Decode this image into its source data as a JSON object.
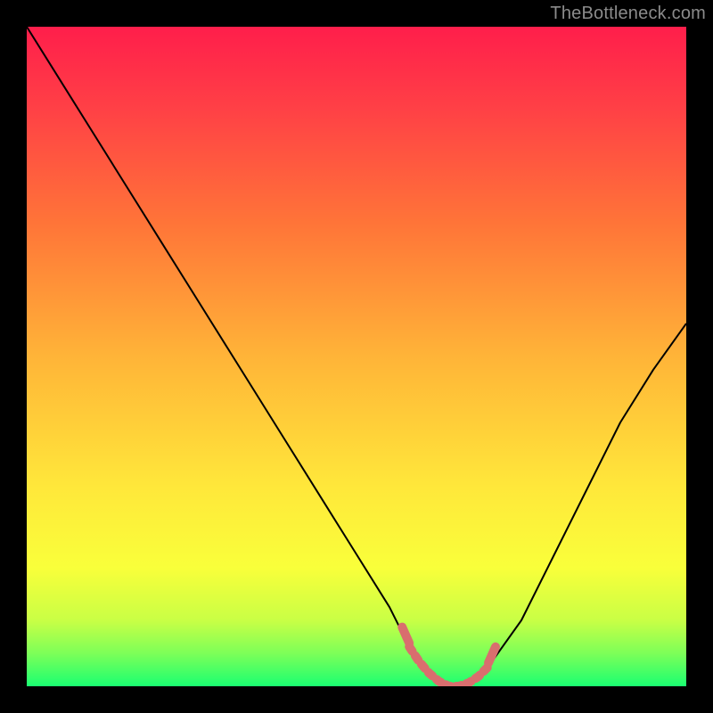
{
  "watermark": "TheBottleneck.com",
  "chart_data": {
    "type": "line",
    "title": "",
    "xlabel": "",
    "ylabel": "",
    "xlim": [
      0,
      100
    ],
    "ylim": [
      0,
      100
    ],
    "x": [
      0,
      5,
      10,
      15,
      20,
      25,
      30,
      35,
      40,
      45,
      50,
      55,
      58,
      60,
      62,
      64,
      66,
      68,
      70,
      75,
      80,
      85,
      90,
      95,
      100
    ],
    "values": [
      100,
      92,
      84,
      76,
      68,
      60,
      52,
      44,
      36,
      28,
      20,
      12,
      6,
      3,
      1,
      0,
      0,
      1,
      3,
      10,
      20,
      30,
      40,
      48,
      55
    ],
    "flat_region": {
      "x_start": 58,
      "x_end": 70,
      "marker_color": "#d96e6e"
    }
  }
}
